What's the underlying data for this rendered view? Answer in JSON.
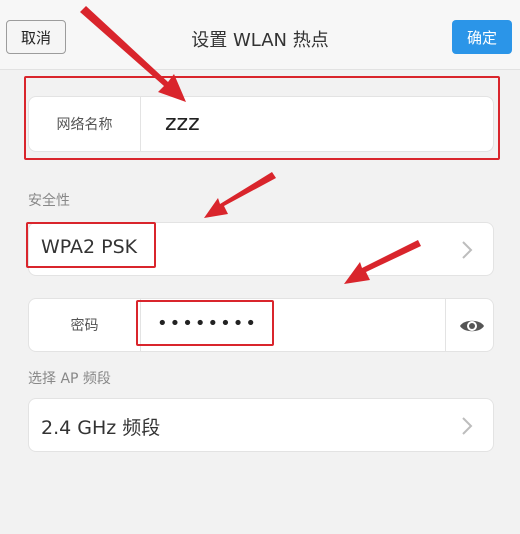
{
  "header": {
    "cancel_label": "取消",
    "title": "设置 WLAN 热点",
    "ok_label": "确定"
  },
  "ssid": {
    "label": "网络名称",
    "value": "zzz"
  },
  "security": {
    "section_label": "安全性",
    "value": "WPA2 PSK"
  },
  "password": {
    "label": "密码",
    "value": "••••••••"
  },
  "band": {
    "section_label": "选择 AP 频段",
    "value": "2.4 GHz 频段"
  },
  "colors": {
    "accent": "#2b95e8",
    "highlight": "#d9252c"
  },
  "icons": [
    "chevron-right-icon",
    "eye-icon",
    "arrow-annotation"
  ]
}
